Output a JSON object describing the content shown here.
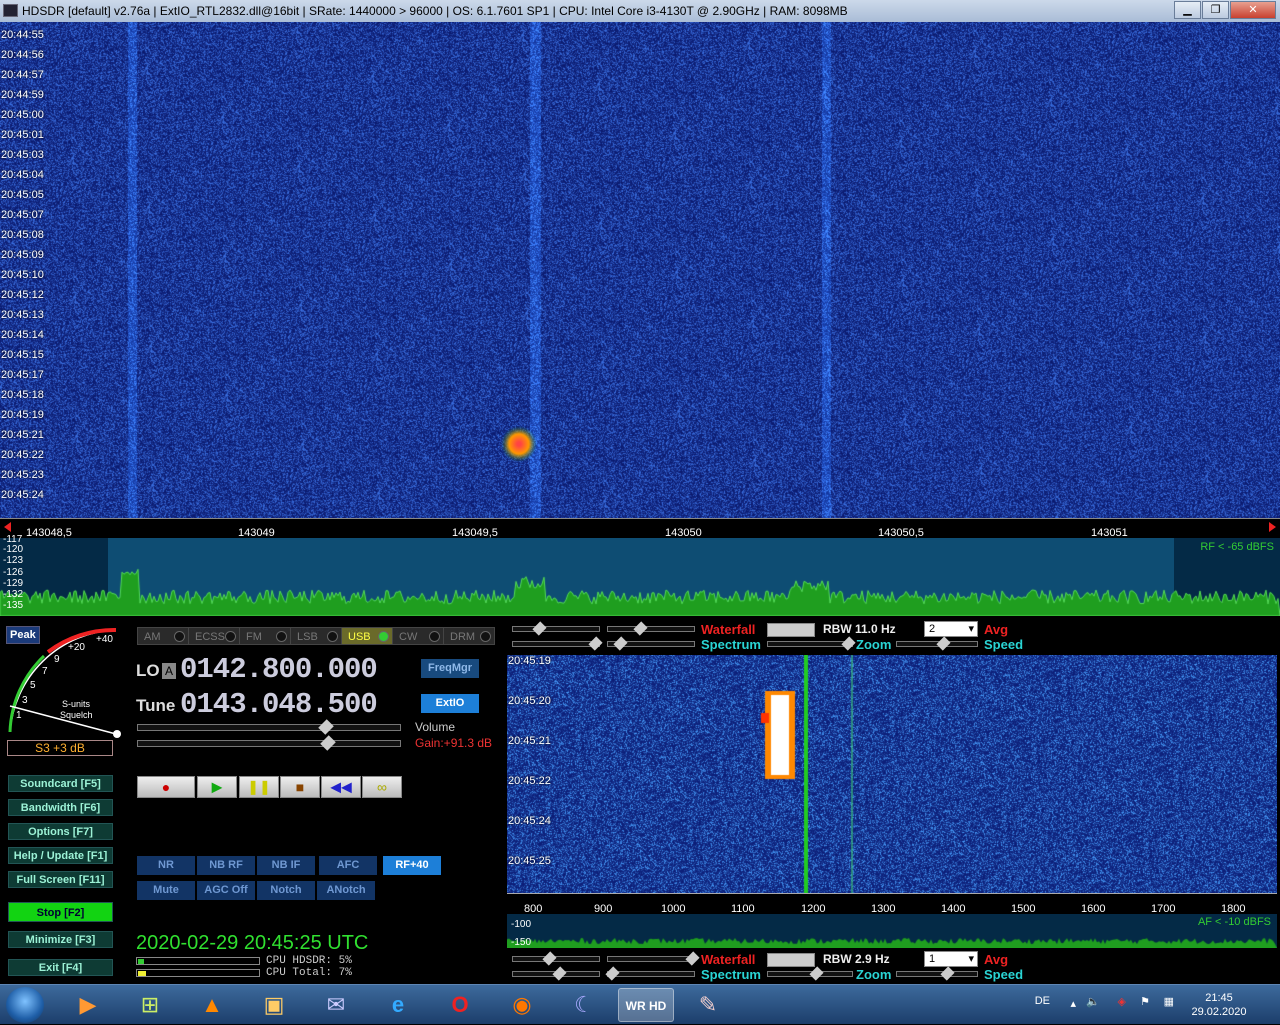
{
  "titlebar": {
    "title": "HDSDR  [default]  v2.76a  |  ExtIO_RTL2832.dll@16bit  |  SRate: 1440000 > 96000  |  OS: 6.1.7601 SP1  |  CPU: Intel Core i3-4130T @ 2.90GHz  |  RAM: 8098MB",
    "minimize_icon": "minimize-icon",
    "maximize_icon": "maximize-icon",
    "close_icon": "close-icon"
  },
  "waterfall_main": {
    "timestamps": [
      "20:44:55",
      "20:44:56",
      "20:44:57",
      "20:44:59",
      "20:45:00",
      "20:45:01",
      "20:45:03",
      "20:45:04",
      "20:45:05",
      "20:45:07",
      "20:45:08",
      "20:45:09",
      "20:45:10",
      "20:45:12",
      "20:45:13",
      "20:45:14",
      "20:45:15",
      "20:45:17",
      "20:45:18",
      "20:45:19",
      "20:45:21",
      "20:45:22",
      "20:45:23",
      "20:45:24"
    ]
  },
  "freq_axis": {
    "ticks": [
      "143048,5",
      "143049",
      "143049,5",
      "143050",
      "143050,5",
      "143051"
    ]
  },
  "spectrum_main": {
    "db_labels": [
      "-117",
      "-120",
      "-123",
      "-126",
      "-129",
      "-132",
      "-135"
    ],
    "rf_label": "RF < -65 dBFS"
  },
  "smeter": {
    "peak_label": "Peak",
    "scale_labels": [
      "+40",
      "+20",
      "9",
      "7",
      "5",
      "3",
      "1"
    ],
    "units_label": "S-units",
    "squelch_label": "Squelch",
    "reading": "S3 +3 dB"
  },
  "modes": [
    {
      "label": "AM",
      "selected": false
    },
    {
      "label": "ECSS",
      "selected": false
    },
    {
      "label": "FM",
      "selected": false
    },
    {
      "label": "LSB",
      "selected": false
    },
    {
      "label": "USB",
      "selected": true
    },
    {
      "label": "CW",
      "selected": false
    },
    {
      "label": "DRM",
      "selected": false
    }
  ],
  "frequency": {
    "lo_label": "LO",
    "lo_box": "A",
    "lo_value": "0142.800.000",
    "tune_label": "Tune",
    "tune_value": "0143.048.500",
    "freqmgr_label": "FreqMgr",
    "extio_label": "ExtIO",
    "volume_label": "Volume",
    "gain_label": "Gain:+91.3 dB",
    "volume_level": 0.72,
    "gain_level": 0.73
  },
  "left_buttons": [
    {
      "label": "Soundcard  [F5]"
    },
    {
      "label": "Bandwidth  [F6]"
    },
    {
      "label": "Options   [F7]"
    },
    {
      "label": "Help / Update  [F1]"
    },
    {
      "label": "Full Screen  [F11]"
    },
    {
      "label": "Stop        [F2]"
    },
    {
      "label": "Minimize  [F3]"
    },
    {
      "label": "Exit      [F4]"
    }
  ],
  "transport": {
    "record_icon": "record-icon",
    "play_icon": "play-icon",
    "pause_icon": "pause-icon",
    "stop_icon": "stop-icon",
    "rewind_icon": "rewind-icon",
    "loop_icon": "loop-icon"
  },
  "filters_row1": [
    {
      "label": "NR",
      "on": false
    },
    {
      "label": "NB RF",
      "on": false
    },
    {
      "label": "NB IF",
      "on": false
    },
    {
      "label": "AFC",
      "on": false
    },
    {
      "label": "RF+40",
      "on": true
    }
  ],
  "filters_row2": [
    {
      "label": "Mute"
    },
    {
      "label": "AGC Off"
    },
    {
      "label": "Notch"
    },
    {
      "label": "ANotch"
    }
  ],
  "status": {
    "clock": "2020-02-29   20:45:25 UTC",
    "cpu_hdsdr": "CPU HDSDR:  5%",
    "cpu_total": "CPU Total:  7%",
    "cpu_hdsdr_pct": 5,
    "cpu_total_pct": 7
  },
  "rf_controls": {
    "waterfall": "Waterfall",
    "spectrum": "Spectrum",
    "rbw": "RBW  11.0 Hz",
    "zoom": "Zoom",
    "avg_value": "2",
    "avg": "Avg",
    "speed": "Speed"
  },
  "waterfall_af": {
    "timestamps": [
      "20:45:19",
      "20:45:20",
      "20:45:21",
      "20:45:22",
      "20:45:24",
      "20:45:25"
    ]
  },
  "af_axis": {
    "ticks": [
      "800",
      "900",
      "1000",
      "1100",
      "1200",
      "1300",
      "1400",
      "1500",
      "1600",
      "1700",
      "1800"
    ]
  },
  "spectrum_af": {
    "db_labels": [
      "-100",
      "-150"
    ],
    "af_label": "AF < -10 dBFS"
  },
  "af_controls": {
    "waterfall": "Waterfall",
    "spectrum": "Spectrum",
    "rbw": "RBW  2.9 Hz",
    "zoom": "Zoom",
    "avg_value": "1",
    "avg": "Avg",
    "speed": "Speed"
  },
  "taskbar": {
    "items": [
      "media-player-icon",
      "network-tool-icon",
      "vlc-icon",
      "explorer-icon",
      "pidgin-icon",
      "ie-icon",
      "opera-icon",
      "firefox-icon",
      "stellarium-icon",
      "hdsdr-icon",
      "paint-icon"
    ],
    "active_index": 9,
    "lang": "DE",
    "time": "21:45",
    "date": "29.02.2020"
  },
  "colors": {
    "waterfall_bg": "#0a1e78",
    "spectrum_fill": "#1f9e1f",
    "button_teal": "#0e3b34",
    "stop_green": "#12d312",
    "freq_blue": "#1d7fd8"
  }
}
